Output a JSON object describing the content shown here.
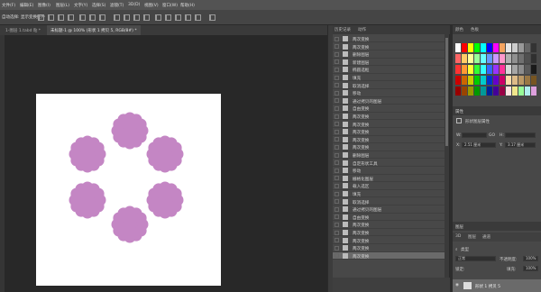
{
  "menubar": {
    "items": [
      "文件(F)",
      "编辑(E)",
      "图像(I)",
      "图层(L)",
      "文字(Y)",
      "选择(S)",
      "滤镜(T)",
      "3D(D)",
      "视图(V)",
      "窗口(W)",
      "帮助(H)"
    ]
  },
  "options": {
    "tool_label": "自动选择: 显示变换控件"
  },
  "doc_tabs": [
    {
      "label": "1-图层 1.tabd 粘 *",
      "active": false
    },
    {
      "label": "未标题-1 @ 100% (形状 1 拷贝 5, RGB/8#) *",
      "active": true
    }
  ],
  "history": {
    "tabs": [
      "历史记录",
      "动作"
    ],
    "items": [
      {
        "label": "两次变换",
        "selected": false
      },
      {
        "label": "两次变换",
        "selected": false
      },
      {
        "label": "删除图层",
        "selected": false
      },
      {
        "label": "新建图层",
        "selected": false
      },
      {
        "label": "椭圆选框",
        "selected": false
      },
      {
        "label": "填充",
        "selected": false
      },
      {
        "label": "取消选择",
        "selected": false
      },
      {
        "label": "移动",
        "selected": false
      },
      {
        "label": "通过拷贝的图层",
        "selected": false
      },
      {
        "label": "自由变换",
        "selected": false
      },
      {
        "label": "两次变换",
        "selected": false
      },
      {
        "label": "两次变换",
        "selected": false
      },
      {
        "label": "两次变换",
        "selected": false
      },
      {
        "label": "两次变换",
        "selected": false
      },
      {
        "label": "两次变换",
        "selected": false
      },
      {
        "label": "删除图层",
        "selected": false
      },
      {
        "label": "自定形状工具",
        "selected": false
      },
      {
        "label": "移动",
        "selected": false
      },
      {
        "label": "栅格化图层",
        "selected": false
      },
      {
        "label": "载入选区",
        "selected": false
      },
      {
        "label": "填充",
        "selected": false
      },
      {
        "label": "取消选择",
        "selected": false
      },
      {
        "label": "通过拷贝的图层",
        "selected": false
      },
      {
        "label": "自由变换",
        "selected": false
      },
      {
        "label": "两次变换",
        "selected": false
      },
      {
        "label": "两次变换",
        "selected": false
      },
      {
        "label": "两次变换",
        "selected": false
      },
      {
        "label": "两次变换",
        "selected": false
      },
      {
        "label": "两次变换",
        "selected": true
      }
    ]
  },
  "swatches_panel": {
    "tabs": [
      "颜色",
      "色板"
    ],
    "colors": [
      "#ffffff",
      "#ff0000",
      "#ffff00",
      "#00ff00",
      "#00ffff",
      "#0000ff",
      "#ff00ff",
      "#f4a460",
      "#e6e6e6",
      "#cccccc",
      "#999999",
      "#666666",
      "#333333",
      "#ff6666",
      "#ffcc66",
      "#ffff99",
      "#99ff99",
      "#66ffff",
      "#6699ff",
      "#cc99ff",
      "#ff99cc",
      "#b0b0b0",
      "#909090",
      "#707070",
      "#505050",
      "#303030",
      "#ff3333",
      "#ff9933",
      "#ffff33",
      "#33ff33",
      "#33ffff",
      "#3366ff",
      "#9933ff",
      "#ff3399",
      "#d9d9d9",
      "#a6a6a6",
      "#8c8c8c",
      "#5a5a5a",
      "#1a1a1a",
      "#cc0000",
      "#cc6600",
      "#cccc00",
      "#00cc00",
      "#00cccc",
      "#0033cc",
      "#6600cc",
      "#cc0066",
      "#ffddaa",
      "#ddbb88",
      "#bb9966",
      "#997744",
      "#775522",
      "#990000",
      "#994400",
      "#999900",
      "#009900",
      "#009999",
      "#002299",
      "#440099",
      "#990044",
      "#ffe4e1",
      "#f0e68c",
      "#98fb98",
      "#afeeee",
      "#dda0dd"
    ]
  },
  "properties": {
    "header": "属性",
    "title": "形状图层属性",
    "w_label": "W:",
    "w_value": "",
    "go_label": "GO",
    "h_label": "H:",
    "h_value": "",
    "x_label": "X:",
    "x_value": "2.51 厘米",
    "y_label": "Y:",
    "y_value": "3.17 厘米"
  },
  "layers": {
    "header": "图层",
    "tabs": [
      "3D",
      "图层",
      "通道"
    ],
    "kind_label": "类型",
    "blend_mode": "正常",
    "opacity_label": "不透明度:",
    "opacity_value": "100%",
    "lock_label": "锁定:",
    "fill_label": "填充:",
    "fill_value": "100%",
    "layer_name": "形状 1 拷贝 5"
  },
  "flower_color": "#c486c4"
}
